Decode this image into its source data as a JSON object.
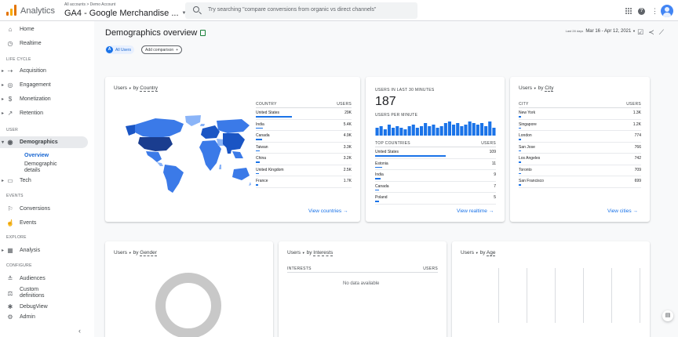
{
  "topbar": {
    "app_name": "Analytics",
    "breadcrumb": "All accounts > Demo Account",
    "property": "GA4 - Google Merchandise ...",
    "search_placeholder": "Try searching \"compare conversions from organic vs direct channels\""
  },
  "sidebar": {
    "home": "Home",
    "realtime": "Realtime",
    "lifecycle": "LIFE CYCLE",
    "acquisition": "Acquisition",
    "engagement": "Engagement",
    "monetization": "Monetization",
    "retention": "Retention",
    "user": "USER",
    "demographics": "Demographics",
    "overview": "Overview",
    "demo_details": "Demographic details",
    "tech": "Tech",
    "events_sec": "EVENTS",
    "conversions": "Conversions",
    "events": "Events",
    "explore": "EXPLORE",
    "analysis": "Analysis",
    "configure": "CONFIGURE",
    "audiences": "Audiences",
    "custom_defs": "Custom definitions",
    "debugview": "DebugView",
    "admin": "Admin"
  },
  "header": {
    "title": "Demographics overview",
    "chip_letter": "A",
    "chip_all": "All Users",
    "add_comparison": "Add comparison",
    "last_days": "Last 28 days",
    "date_range": "Mar 16 - Apr 12, 2021"
  },
  "country_card": {
    "metric": "Users",
    "by": "by",
    "dimension": "Country",
    "col_country": "COUNTRY",
    "col_users": "USERS",
    "rows": [
      {
        "name": "United States",
        "value": "29K",
        "share": 1.0
      },
      {
        "name": "India",
        "value": "5.4K",
        "share": 0.19
      },
      {
        "name": "Canada",
        "value": "4.9K",
        "share": 0.17
      },
      {
        "name": "Taiwan",
        "value": "3.3K",
        "share": 0.11
      },
      {
        "name": "China",
        "value": "3.2K",
        "share": 0.11
      },
      {
        "name": "United Kingdom",
        "value": "2.5K",
        "share": 0.09
      },
      {
        "name": "France",
        "value": "1.7K",
        "share": 0.06
      }
    ],
    "link": "View countries",
    "colors": {
      "dark": "#1a55c4",
      "mid": "#3b7ae8",
      "light": "#8ab4f8",
      "none": "#dadce0"
    }
  },
  "realtime_card": {
    "label": "USERS IN LAST 30 MINUTES",
    "value": "187",
    "per_minute": "USERS PER MINUTE",
    "col_country": "TOP COUNTRIES",
    "col_users": "USERS",
    "minute_bars": [
      5,
      6,
      4,
      7,
      5,
      6,
      5,
      4,
      6,
      7,
      5,
      6,
      8,
      6,
      7,
      5,
      6,
      8,
      9,
      7,
      8,
      6,
      7,
      9,
      8,
      7,
      8,
      6,
      9,
      5
    ],
    "rows": [
      {
        "name": "United States",
        "value": "109",
        "share": 1.0
      },
      {
        "name": "Estonia",
        "value": "11",
        "share": 0.1
      },
      {
        "name": "India",
        "value": "9",
        "share": 0.08
      },
      {
        "name": "Canada",
        "value": "7",
        "share": 0.06
      },
      {
        "name": "Poland",
        "value": "5",
        "share": 0.05
      }
    ],
    "link": "View realtime"
  },
  "city_card": {
    "metric": "Users",
    "by": "by",
    "dimension": "City",
    "col_city": "CITY",
    "col_users": "USERS",
    "rows": [
      {
        "name": "New York",
        "value": "1.3K",
        "share": 0.05
      },
      {
        "name": "Singapore",
        "value": "1.2K",
        "share": 0.05
      },
      {
        "name": "London",
        "value": "774",
        "share": 0.04
      },
      {
        "name": "San Jose",
        "value": "766",
        "share": 0.04
      },
      {
        "name": "Los Angeles",
        "value": "742",
        "share": 0.04
      },
      {
        "name": "Toronto",
        "value": "709",
        "share": 0.04
      },
      {
        "name": "San Francisco",
        "value": "699",
        "share": 0.04
      }
    ],
    "link": "View cities"
  },
  "gender_card": {
    "metric": "Users",
    "by": "by",
    "dimension": "Gender"
  },
  "interests_card": {
    "metric": "Users",
    "by": "by",
    "dimension": "Interests",
    "col_interests": "INTERESTS",
    "col_users": "USERS",
    "empty": "No data available"
  },
  "age_card": {
    "metric": "Users",
    "by": "by",
    "dimension": "Age"
  }
}
